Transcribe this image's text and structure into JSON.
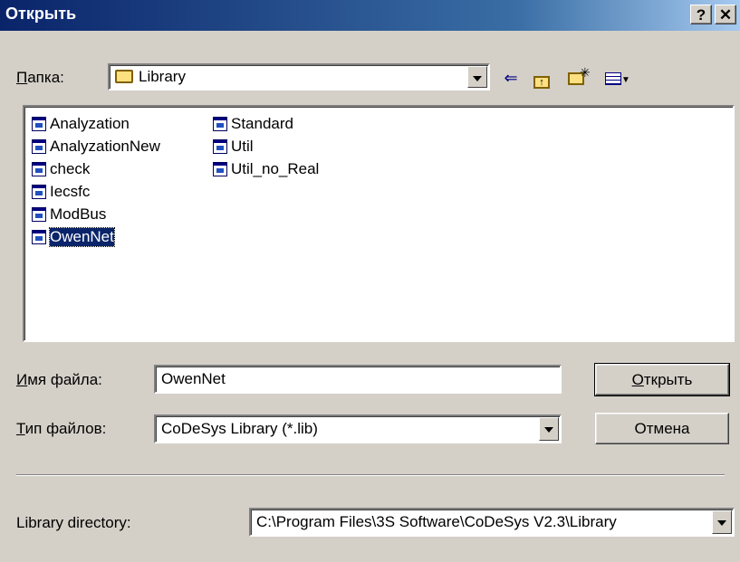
{
  "window": {
    "title": "Открыть",
    "help_label": "?",
    "close_label": "✕"
  },
  "lookin": {
    "label_u": "П",
    "label_rest": "апка:",
    "value": "Library",
    "toolbar_icons": [
      "back-arrow-icon",
      "up-folder-icon",
      "new-folder-icon",
      "view-menu-icon"
    ]
  },
  "files": [
    {
      "name": "Analyzation",
      "selected": false
    },
    {
      "name": "AnalyzationNew",
      "selected": false
    },
    {
      "name": "check",
      "selected": false
    },
    {
      "name": "Iecsfc",
      "selected": false
    },
    {
      "name": "ModBus",
      "selected": false
    },
    {
      "name": "OwenNet",
      "selected": true
    },
    {
      "name": "Standard",
      "selected": false
    },
    {
      "name": "Util",
      "selected": false
    },
    {
      "name": "Util_no_Real",
      "selected": false
    }
  ],
  "filename": {
    "label_u": "И",
    "label_rest": "мя файла:",
    "value": "OwenNet"
  },
  "filetype": {
    "label_u": "Т",
    "label_rest": "ип файлов:",
    "value": "CoDeSys Library (*.lib)"
  },
  "buttons": {
    "open_u": "О",
    "open_rest": "ткрыть",
    "cancel": "Отмена"
  },
  "libdir": {
    "label": "Library directory:",
    "value": "C:\\Program Files\\3S Software\\CoDeSys V2.3\\Library"
  }
}
